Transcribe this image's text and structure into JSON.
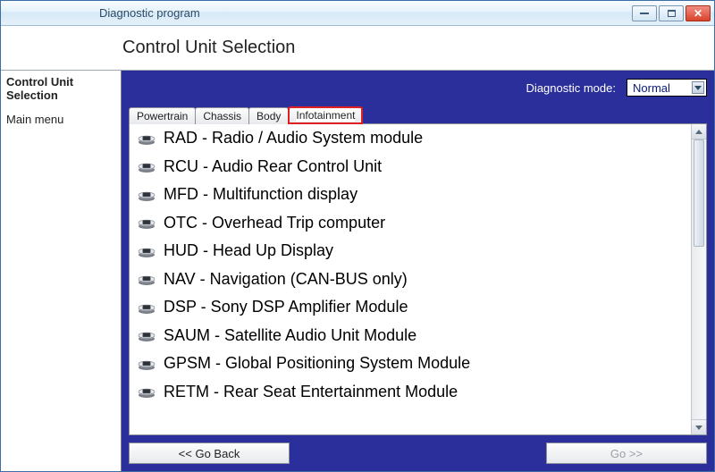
{
  "window": {
    "title": "Diagnostic program"
  },
  "header": {
    "title": "Control Unit Selection"
  },
  "sidebar": {
    "items": [
      {
        "label": "Control Unit Selection",
        "bold": true
      },
      {
        "label": "Main menu",
        "bold": false
      }
    ]
  },
  "diagnostic": {
    "label": "Diagnostic mode:",
    "selected": "Normal"
  },
  "tabs": [
    {
      "label": "Powertrain",
      "active": false
    },
    {
      "label": "Chassis",
      "active": false
    },
    {
      "label": "Body",
      "active": false
    },
    {
      "label": "Infotainment",
      "active": true
    }
  ],
  "modules": [
    "RAD - Radio / Audio System module",
    "RCU - Audio Rear Control Unit",
    "MFD - Multifunction display",
    "OTC - Overhead Trip computer",
    "HUD - Head Up Display",
    "NAV - Navigation (CAN-BUS only)",
    "DSP - Sony DSP Amplifier Module",
    "SAUM - Satellite Audio Unit Module",
    "GPSM - Global Positioning System Module",
    "RETM - Rear Seat Entertainment Module"
  ],
  "footer": {
    "back": "<< Go Back",
    "go": "Go >>"
  }
}
